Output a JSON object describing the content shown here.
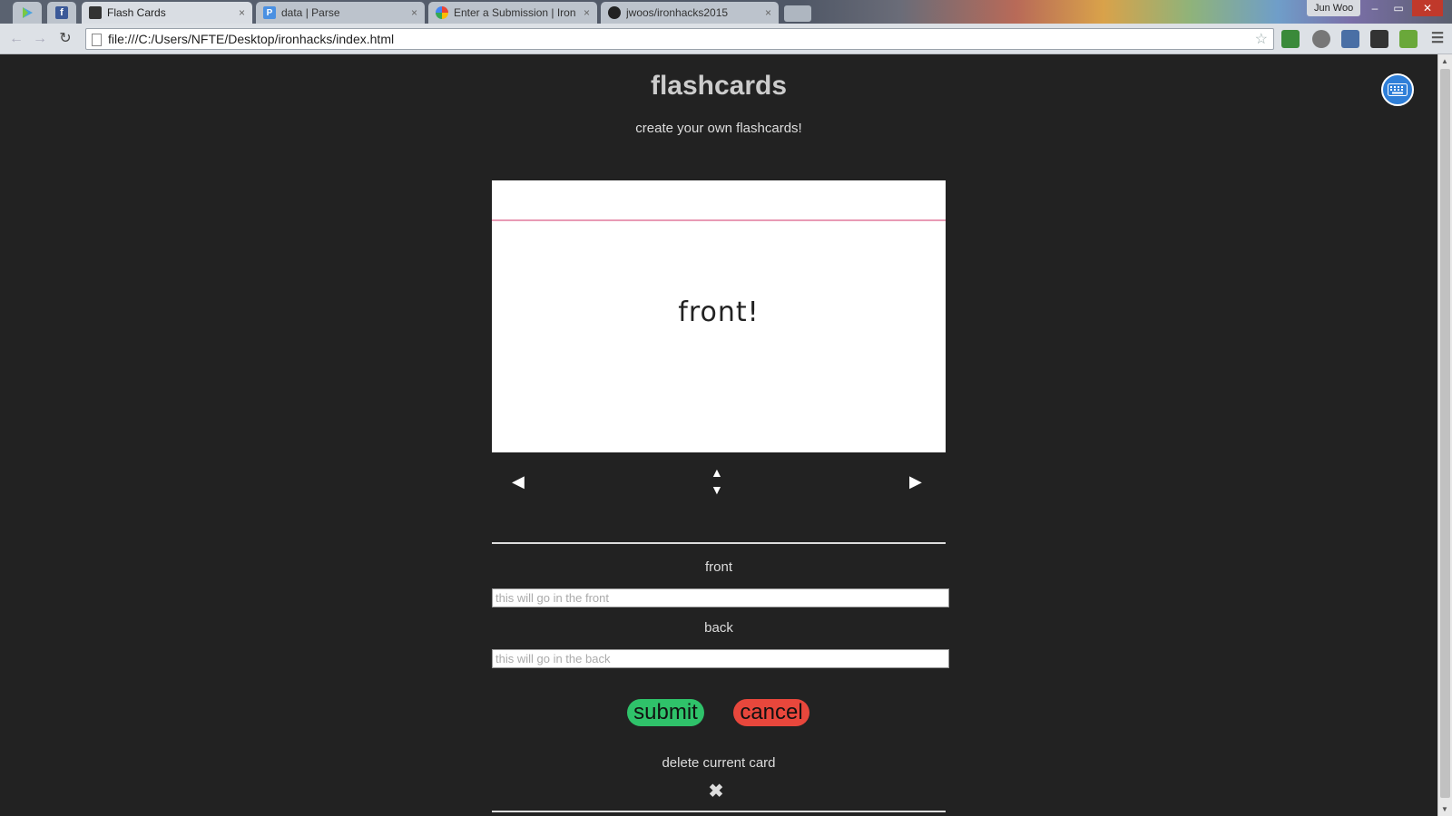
{
  "browser": {
    "tabs": [
      {
        "title": "Flash Cards",
        "active": true
      },
      {
        "title": "data | Parse",
        "active": false
      },
      {
        "title": "Enter a Submission | Iron I",
        "active": false
      },
      {
        "title": "jwoos/ironhacks2015",
        "active": false
      }
    ],
    "close_glyph": "×",
    "user": "Jun Woo",
    "url": "file:///C:/Users/NFTE/Desktop/ironhacks/index.html",
    "window_controls": [
      "–",
      "▭",
      "✕"
    ]
  },
  "page": {
    "title": "flashcards",
    "subtitle": "create your own flashcards!",
    "card_text": "front!",
    "controls": {
      "prev_glyph": "◀",
      "flip_up_glyph": "▲",
      "flip_down_glyph": "▼",
      "next_glyph": "▶"
    },
    "form": {
      "front_label": "front",
      "front_placeholder": "this will go in the front",
      "back_label": "back",
      "back_placeholder": "this will go in the back",
      "submit_label": "submit",
      "cancel_label": "cancel"
    },
    "delete_label": "delete current card",
    "delete_glyph": "✖"
  },
  "colors": {
    "page_bg": "#222222",
    "submit": "#2fc26a",
    "cancel": "#e8473c",
    "card_margin_line": "#e89bb5",
    "card_rule_line": "#8fb7e0",
    "keyboard_button": "#2f7fd8"
  },
  "icons": [
    "play-store-icon",
    "facebook-icon",
    "flash-cards-icon",
    "parse-icon",
    "google-icon",
    "github-icon",
    "page-icon",
    "star-icon",
    "keyboard-icon",
    "close-icon",
    "arrow-left-icon",
    "arrow-right-icon",
    "arrow-up-icon",
    "arrow-down-icon"
  ]
}
